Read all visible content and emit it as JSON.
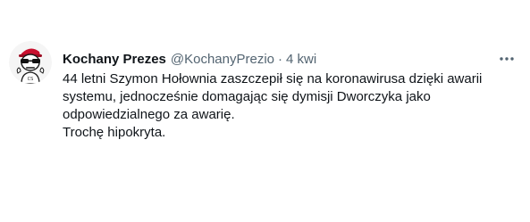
{
  "tweet": {
    "display_name": "Kochany Prezes",
    "handle": "@KochanyPrezio",
    "separator": "·",
    "time": "4 kwi",
    "avatar_icon": "skeleton-with-sunglasses-and-red-cap-icon",
    "more_icon": "more-options-icon",
    "lines": [
      "44 letni Szymon Hołownia zaszczepił się na koronawirusa dzięki awarii",
      "systemu, jednocześnie domagając się dymisji Dworczyka jako",
      "odpowiedzialnego za awarię.",
      "Trochę hipokryta."
    ]
  },
  "colors": {
    "text": "#0f1419",
    "secondary": "#536471",
    "cap": "#c8102e"
  }
}
